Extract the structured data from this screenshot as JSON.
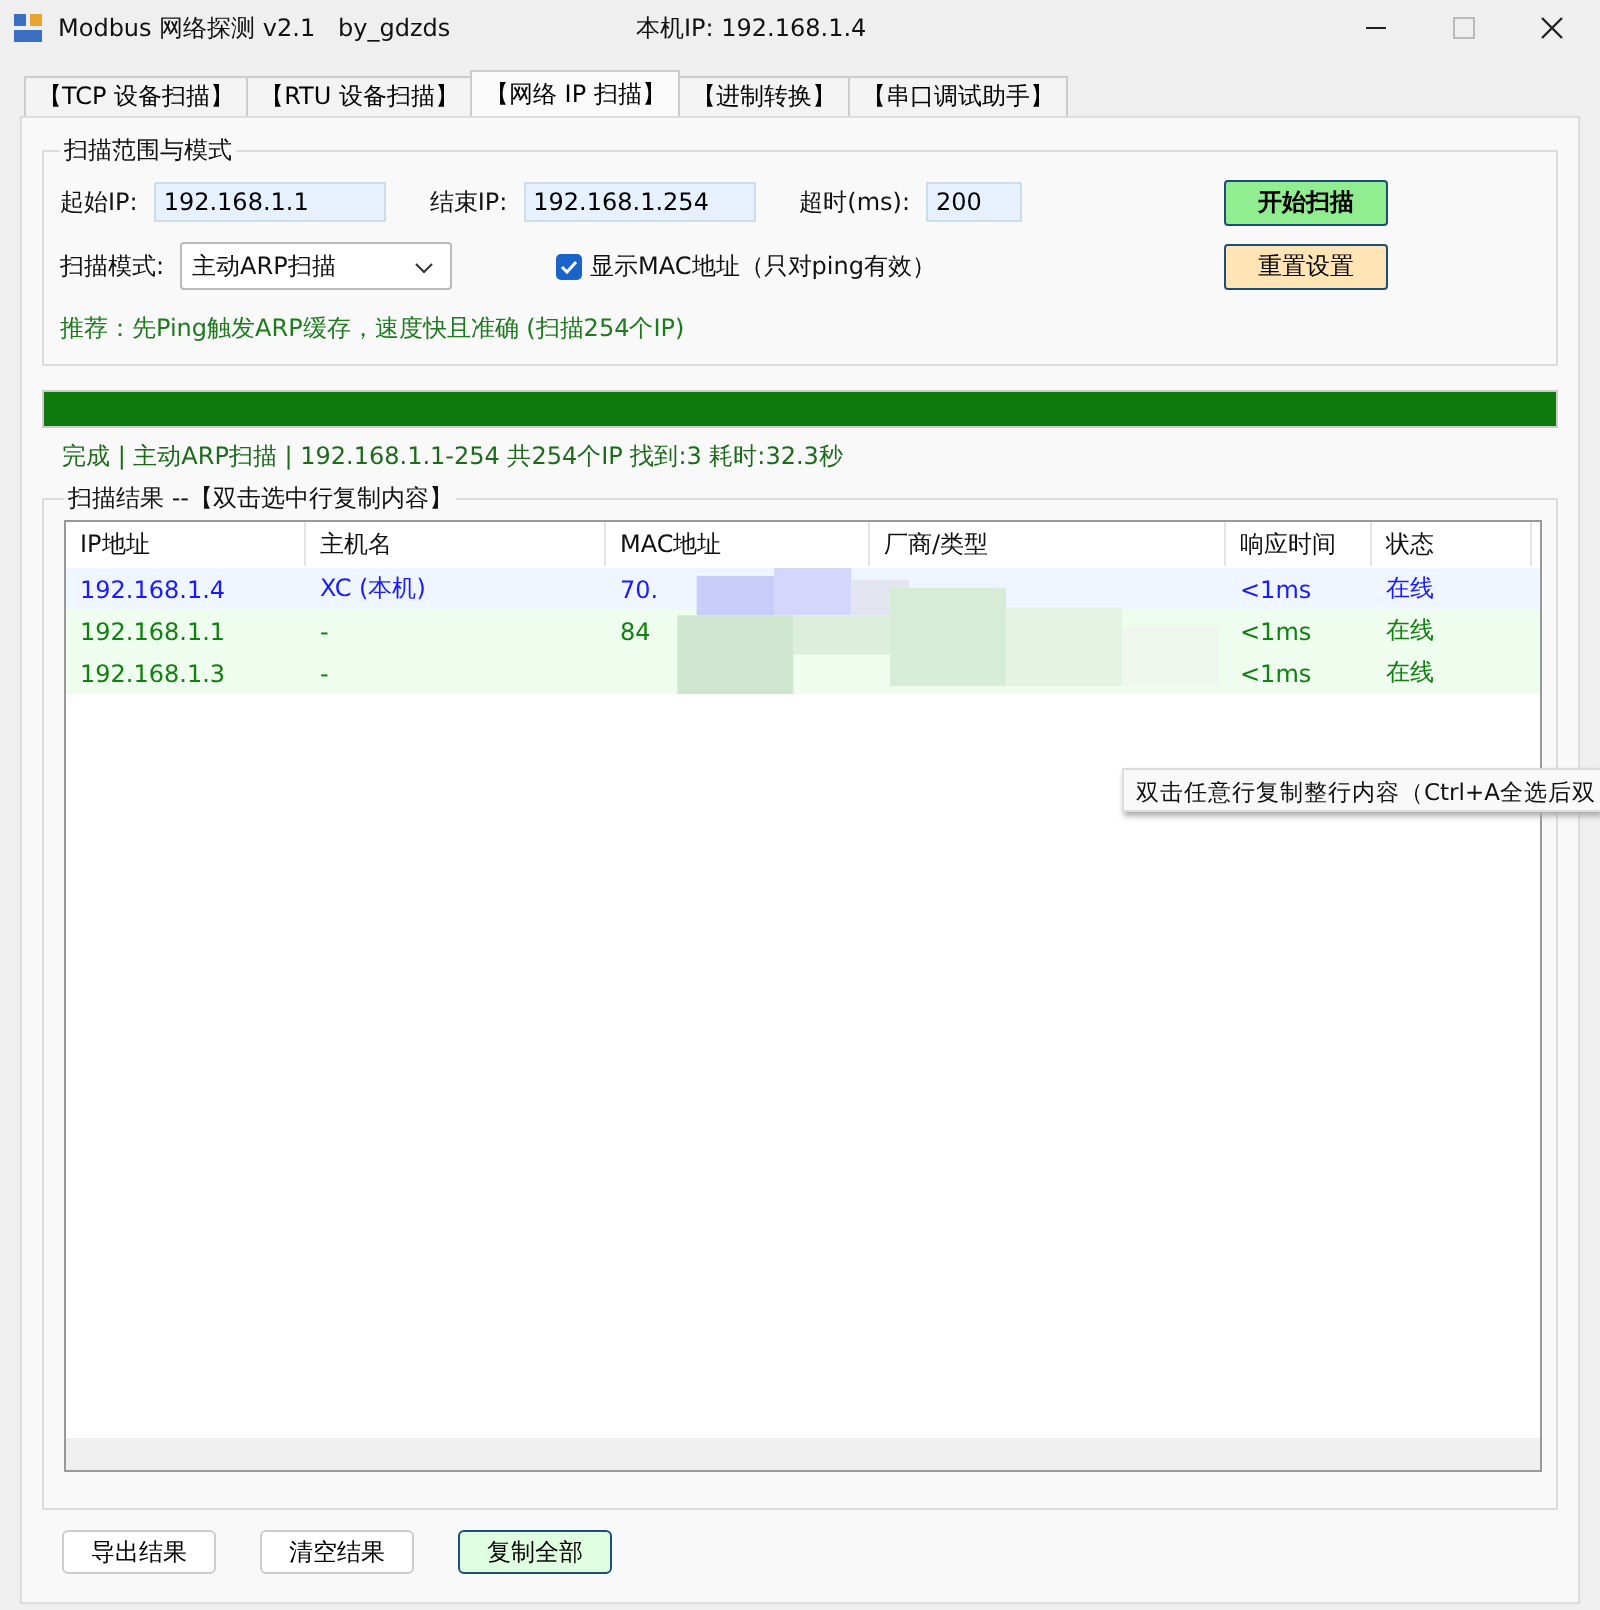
{
  "window": {
    "title": "Modbus 网络探测 v2.1   by_gdzds",
    "local_ip": "本机IP: 192.168.1.4"
  },
  "tabs": [
    {
      "label": "【TCP 设备扫描】",
      "selected": false
    },
    {
      "label": "【RTU 设备扫描】",
      "selected": false
    },
    {
      "label": "【网络 IP 扫描】",
      "selected": true
    },
    {
      "label": "【进制转换】",
      "selected": false
    },
    {
      "label": "【串口调试助手】",
      "selected": false
    }
  ],
  "scan_group": {
    "title": "扫描范围与模式",
    "start_label": "起始IP:",
    "start_value": "192.168.1.1",
    "end_label": "结束IP:",
    "end_value": "192.168.1.254",
    "timeout_label": "超时(ms):",
    "timeout_value": "200",
    "mode_label": "扫描模式:",
    "mode_value": "主动ARP扫描",
    "show_mac": {
      "label": "显示MAC地址（只对ping有效）",
      "checked": true
    },
    "start_button": "开始扫描",
    "reset_button": "重置设置",
    "hint": "推荐：先Ping触发ARP缓存，速度快且准确 (扫描254个IP)"
  },
  "progress": {
    "level": 1
  },
  "status": "完成 | 主动ARP扫描 | 192.168.1.1-254  共254个IP  找到:3  耗时:32.3秒",
  "results": {
    "title": "扫描结果 --【双击选中行复制内容】",
    "columns": [
      "IP地址",
      "主机名",
      "MAC地址",
      "厂商/类型",
      "响应时间",
      "状态"
    ],
    "rows": [
      {
        "kind": "local",
        "ip": "192.168.1.4",
        "host": "XC (本机)",
        "mac": "70.",
        "time": "<1ms",
        "state": "在线"
      },
      {
        "kind": "online",
        "ip": "192.168.1.1",
        "host": "-",
        "mac": "84",
        "time": "<1ms",
        "state": "在线"
      },
      {
        "kind": "online",
        "ip": "192.168.1.3",
        "host": "-",
        "time": "<1ms",
        "state": "在线"
      }
    ]
  },
  "tooltip": "双击任意行复制整行内容（Ctrl+A全选后双",
  "buttons": [
    {
      "label": "导出结果",
      "kind": "plain"
    },
    {
      "label": "清空结果",
      "kind": "plain"
    },
    {
      "label": "复制全部",
      "kind": "accent"
    }
  ]
}
